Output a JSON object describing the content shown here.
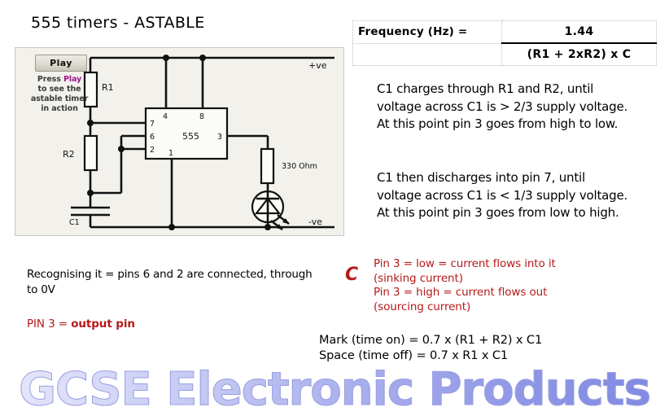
{
  "slide": {
    "title": "555 timers - ASTABLE",
    "footer_title": "GCSE Electronic Products"
  },
  "simulation": {
    "play_button_label": "Play",
    "hint_line1_prefix": "Press ",
    "hint_line1_emph": "Play",
    "hint_line2": "to see the",
    "hint_line3": "astable timer",
    "hint_line4": "in action",
    "circuit": {
      "chip_label": "555",
      "pin_top_left": "4",
      "pin_top_right": "8",
      "pin_left_1": "7",
      "pin_left_2": "6",
      "pin_left_3": "2",
      "pin_right": "3",
      "pin_bottom": "1",
      "resistor_r1_label": "R1",
      "resistor_r2_label": "R2",
      "capacitor_label": "C1",
      "led_resistor_label": "330 Ohm",
      "rail_positive": "+ve",
      "rail_negative": "-ve"
    }
  },
  "formula": {
    "label": "Frequency (Hz) =",
    "numerator": "1.44",
    "denominator": "(R1 + 2xR2) x C"
  },
  "explanations": {
    "charging": "C1 charges through R1 and R2, until voltage across C1 is > 2/3 supply voltage. At this point pin 3 goes from high to low.",
    "discharging": "C1 then discharges into pin 7, until voltage across C1 is < 1/3 supply voltage. At this point pin 3 goes from low to high."
  },
  "notes": {
    "recognising": "Recognising it = pins 6 and 2 are connected, through",
    "recognising_line2": "to 0V",
    "recognising_capacitor_symbol": "C",
    "pin3_prefix": "PIN 3 = ",
    "pin3_emph": "output pin"
  },
  "current_direction": {
    "line1": "Pin 3 = low = current flows into it",
    "line2": "(sinking current)",
    "line3": "Pin 3 = high = current flows out",
    "line4": "(sourcing current)"
  },
  "timing": {
    "mark": "Mark (time on) = 0.7 x (R1 + R2) x C1",
    "space": "Space (time off) = 0.7 x R1 x C1"
  },
  "colors": {
    "red_text": "#b51a1a",
    "magenta": "#a0148c",
    "footer_gradient_start": "#e8e9fb",
    "footer_gradient_end": "#7f88e3",
    "panel_bg": "#f2f1ec"
  }
}
